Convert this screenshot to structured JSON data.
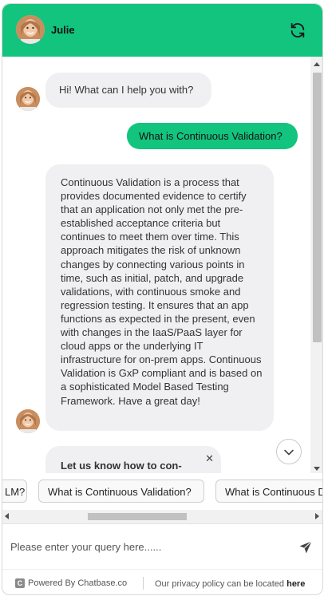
{
  "header": {
    "agent_name": "Julie",
    "avatar_icon": "agent-avatar",
    "refresh_icon": "refresh-icon",
    "background_color": "#12c47e"
  },
  "messages": [
    {
      "role": "bot",
      "text": "Hi! What can I help you with?"
    },
    {
      "role": "user",
      "text": "What is Continuous Validation?"
    },
    {
      "role": "bot",
      "text": "Continuous Validation is a process that provides documented evidence to certify that an application not only met the pre-established acceptance criteria but continues to meet them over time. This approach mitigates the risk of unknown changes by connecting various points in time, such as initial, patch, and upgrade validations, with continuous smoke and regression testing. It ensures that an app functions as expected in the present, even with changes in the IaaS/PaaS layer for cloud apps or the underlying IT infrastructure for on-prem apps. Continuous Validation is GxP compliant and is based on a sophisticated Model Based Testing Framework. Have a great day!"
    },
    {
      "role": "bot",
      "text": "Let us know how to con-"
    }
  ],
  "popup": {
    "close_label": "✕"
  },
  "suggestions": [
    "LM?",
    "What is Continuous Validation?",
    "What is Continuous D"
  ],
  "input": {
    "placeholder": "Please enter your query here......",
    "value": ""
  },
  "footer": {
    "logo_letter": "C",
    "powered_by": "Powered By Chatbase.co",
    "policy_text": "Our privacy policy can be located",
    "policy_link": "here"
  }
}
